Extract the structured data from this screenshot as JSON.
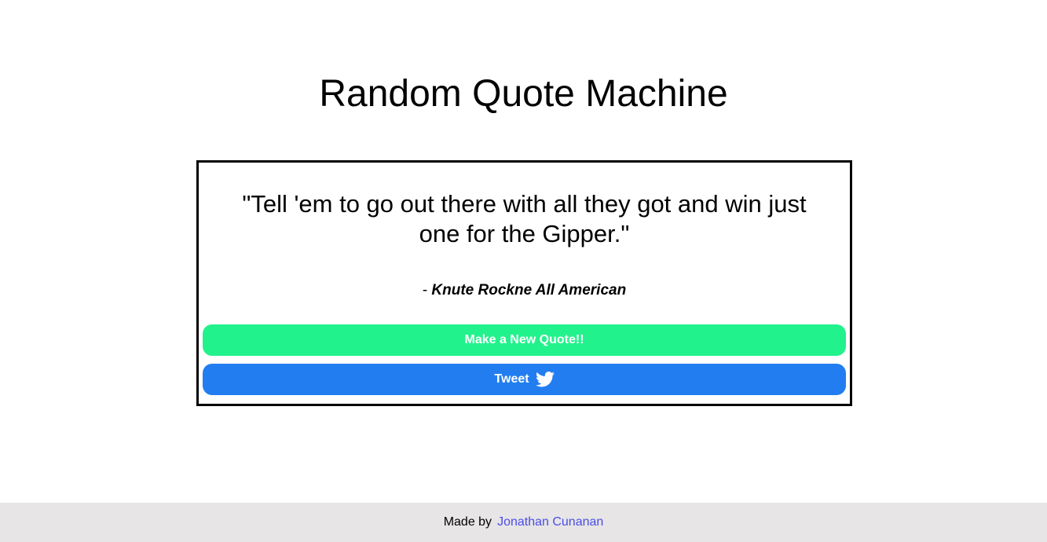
{
  "header": {
    "title": "Random Quote Machine"
  },
  "quote": {
    "text": "\"Tell 'em to go out there with all they got and win just one for the Gipper.\"",
    "author_prefix": "- ",
    "author": "Knute Rockne All American"
  },
  "buttons": {
    "new_quote_label": "Make a New Quote!!",
    "tweet_label": "Tweet",
    "tweet_icon": "twitter-bird-icon"
  },
  "footer": {
    "made_by_label": "Made by",
    "author_link_text": "Jonathan Cunanan"
  },
  "colors": {
    "new_quote_button": "#22f28c",
    "tweet_button": "#227ef0",
    "footer_background": "#e7e5e6",
    "link": "#4a4ee8"
  }
}
